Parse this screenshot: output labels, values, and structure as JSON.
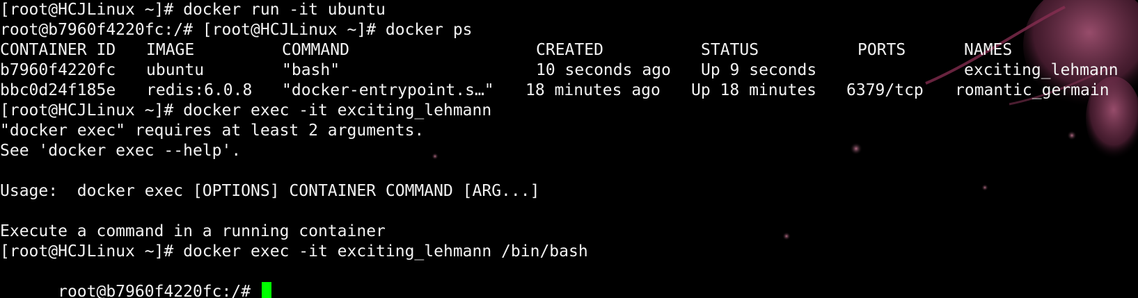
{
  "terminal": {
    "lines": [
      "[root@HCJLinux ~]# docker run -it ubuntu",
      "root@b7960f4220fc:/# [root@HCJLinux ~]# docker ps"
    ],
    "table": {
      "headers": [
        "CONTAINER ID",
        "IMAGE",
        "COMMAND",
        "CREATED",
        "STATUS",
        "PORTS",
        "NAMES"
      ],
      "rows": [
        [
          "b7960f4220fc",
          "ubuntu",
          "\"bash\"",
          "10 seconds ago",
          "Up 9 seconds",
          "",
          "exciting_lehmann"
        ],
        [
          "bbc0d24f185e",
          "redis:6.0.8",
          "\"docker-entrypoint.s…\"",
          "18 minutes ago",
          "Up 18 minutes",
          "6379/tcp",
          "romantic_germain"
        ]
      ]
    },
    "after_lines": [
      "[root@HCJLinux ~]# docker exec -it exciting_lehmann",
      "\"docker exec\" requires at least 2 arguments.",
      "See 'docker exec --help'.",
      "",
      "Usage:  docker exec [OPTIONS] CONTAINER COMMAND [ARG...]",
      "",
      "Execute a command in a running container",
      "[root@HCJLinux ~]# docker exec -it exciting_lehmann /bin/bash"
    ],
    "prompt": "root@b7960f4220fc:/# ",
    "colors": {
      "background": "#000000",
      "text": "#f2f2f2",
      "cursor": "#00ff00"
    }
  }
}
